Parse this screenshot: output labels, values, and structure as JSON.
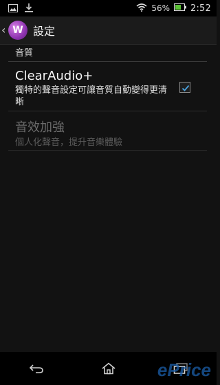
{
  "status_bar": {
    "battery_percent": "56%",
    "time": "2:52",
    "icons": [
      "gallery-notification-icon",
      "download-notification-icon",
      "wifi-icon",
      "battery-icon"
    ]
  },
  "action_bar": {
    "title": "設定",
    "app_icon_letter": "W"
  },
  "section": {
    "header": "音質"
  },
  "preferences": [
    {
      "title": "ClearAudio+",
      "summary": "獨特的聲音設定可讓音質自動變得更清晰",
      "checked": true,
      "enabled": true
    },
    {
      "title": "音效加強",
      "summary": "個人化聲音，提升音樂體驗",
      "enabled": false
    }
  ],
  "watermark": {
    "text": "ePrice"
  },
  "colors": {
    "accent_purple": "#8e34b0",
    "checkmark": "#4aa3df",
    "watermark_blue": "#1b5ea8"
  }
}
